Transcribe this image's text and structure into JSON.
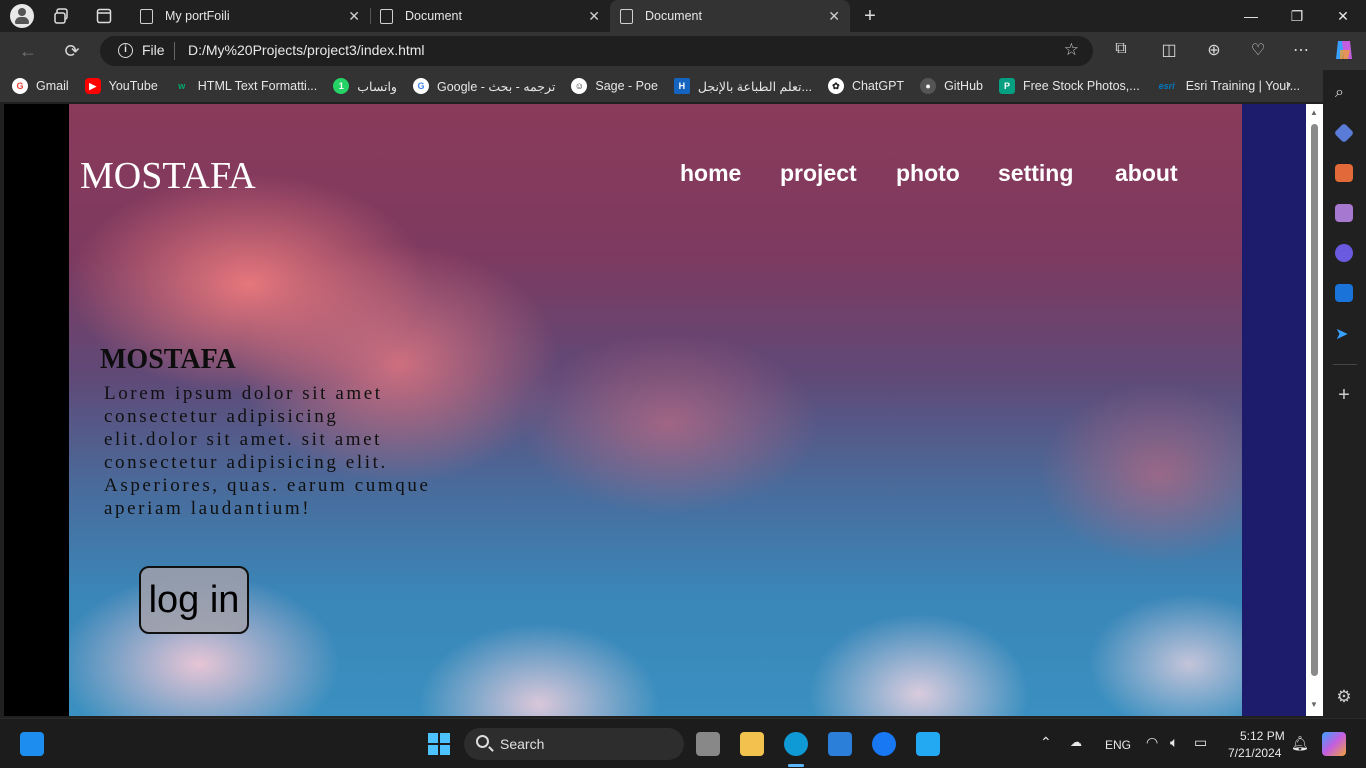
{
  "browser": {
    "tabs": [
      {
        "title": "My portFoili"
      },
      {
        "title": "Document"
      },
      {
        "title": "Document"
      }
    ],
    "address": {
      "scheme_label": "File",
      "url": "D:/My%20Projects/project3/index.html"
    },
    "bookmarks": [
      {
        "label": "Gmail",
        "icon": "gmail-icon",
        "color": "#ea4335"
      },
      {
        "label": "YouTube",
        "icon": "youtube-icon",
        "color": "#ff0000"
      },
      {
        "label": "HTML Text Formatti...",
        "icon": "w3schools-icon",
        "color": "#04aa6d"
      },
      {
        "label": "واتساب",
        "icon": "whatsapp-icon",
        "color": "#25d366"
      },
      {
        "label": "Google - ترجمه - بحث",
        "icon": "google-icon",
        "color": "#4285f4"
      },
      {
        "label": "Sage - Poe",
        "icon": "poe-icon",
        "color": "#444444"
      },
      {
        "label": "تعلم الطباعة بالإنجل...",
        "icon": "h-icon",
        "color": "#1565c0"
      },
      {
        "label": "ChatGPT",
        "icon": "chatgpt-icon",
        "color": "#dddddd"
      },
      {
        "label": "GitHub",
        "icon": "github-icon",
        "color": "#555555"
      },
      {
        "label": "Free Stock Photos,...",
        "icon": "pexels-icon",
        "color": "#05a081"
      },
      {
        "label": "Esri Training | Your...",
        "icon": "esri-icon",
        "color": "#0079c1"
      }
    ]
  },
  "site": {
    "logo": "MOSTAFA",
    "nav": [
      "home",
      "project",
      "photo",
      "setting",
      "about"
    ],
    "content_title": "MOSTAFA",
    "content_text": "Lorem ipsum dolor sit amet consectetur adipisicing elit.dolor sit amet. sit amet consectetur adipisicing elit. Asperiores, quas. earum cumque aperiam laudantium!",
    "login_label": "log in"
  },
  "taskbar": {
    "search_label": "Search",
    "language": "ENG",
    "time": "5:12 PM",
    "date": "7/21/2024"
  }
}
